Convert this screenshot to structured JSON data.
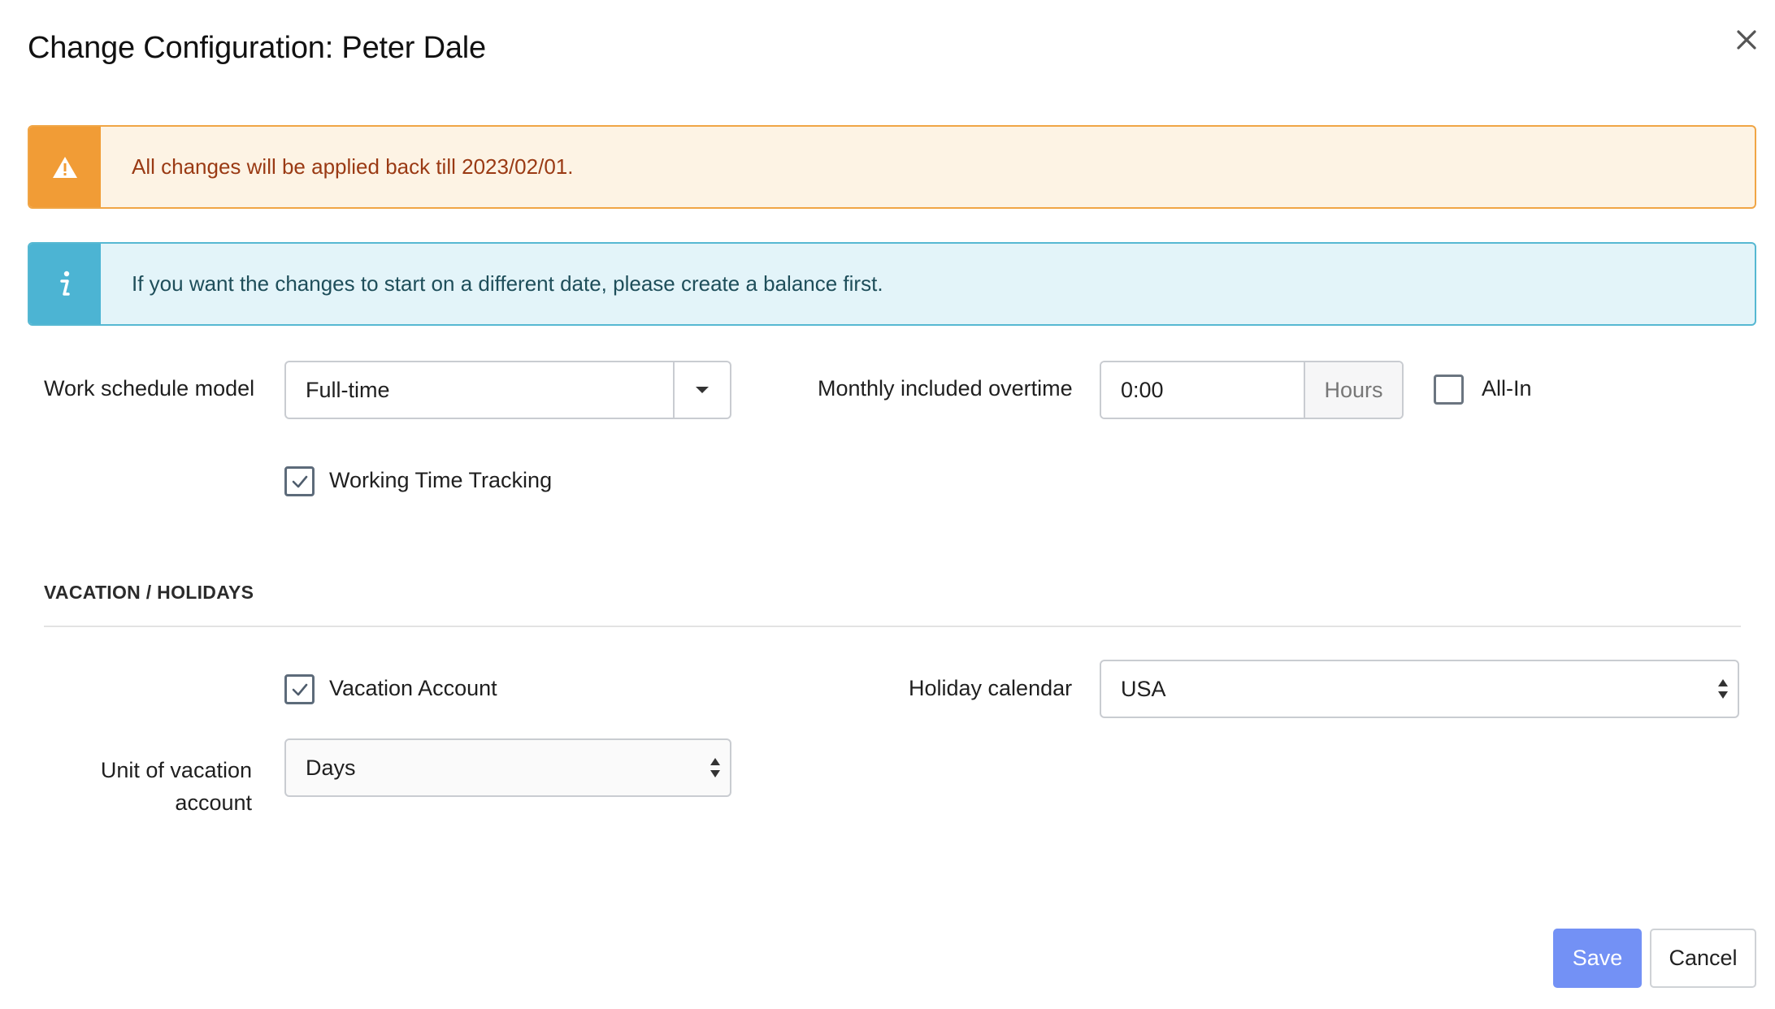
{
  "dialog": {
    "title": "Change Configuration: Peter Dale",
    "close_icon": "close-icon"
  },
  "alerts": {
    "warning": {
      "icon": "warning-icon",
      "text": "All changes will be applied back till 2023/02/01.",
      "color": "#f19c36"
    },
    "info": {
      "icon": "info-icon",
      "text": "If you want the changes to start on a different date, please create a balance first.",
      "color": "#4cb4d3"
    }
  },
  "work": {
    "schedule_label": "Work schedule model",
    "schedule_value": "Full-time",
    "overtime_label": "Monthly included overtime",
    "overtime_value": "0:00",
    "overtime_unit": "Hours",
    "all_in_label": "All-In",
    "all_in_checked": false,
    "tracking_label": "Working Time Tracking",
    "tracking_checked": true
  },
  "vacation": {
    "section_title": "VACATION / HOLIDAYS",
    "account_label": "Vacation Account",
    "account_checked": true,
    "holiday_label": "Holiday calendar",
    "holiday_value": "USA",
    "unit_label_line1": "Unit of vacation",
    "unit_label_line2": "account",
    "unit_value": "Days"
  },
  "footer": {
    "save_label": "Save",
    "cancel_label": "Cancel",
    "accent": "#7391f5"
  }
}
